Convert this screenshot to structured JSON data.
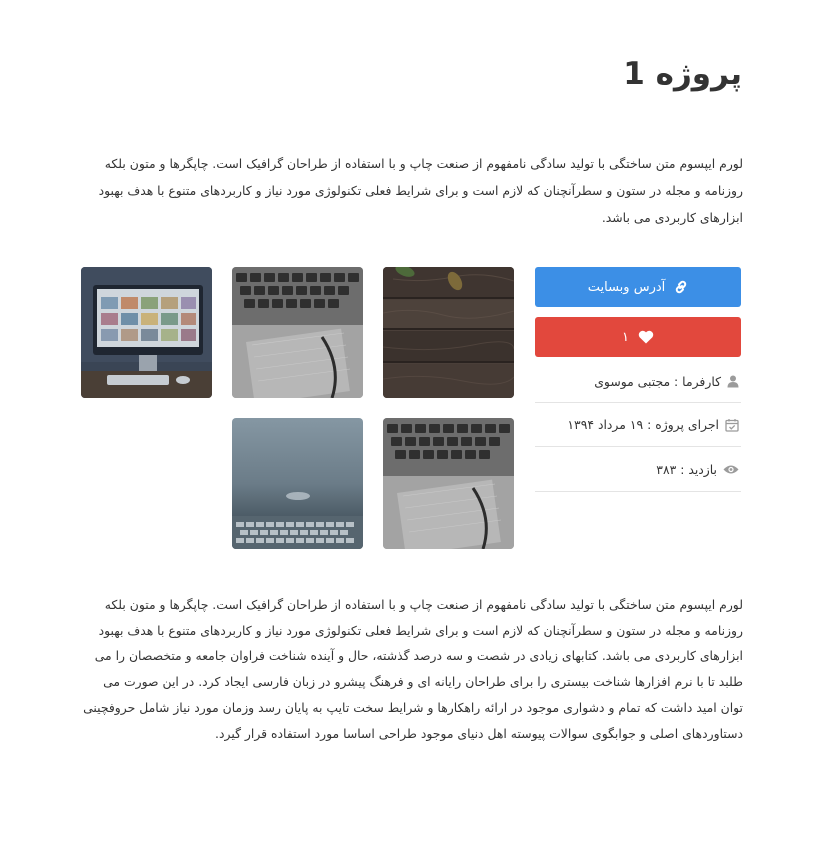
{
  "page": {
    "title": "پروژه 1"
  },
  "intro_text": "لورم ایپسوم متن ساختگی با تولید سادگی نامفهوم از صنعت چاپ و با استفاده از طراحان گرافیک است. چاپگرها و متون بلکه روزنامه و مجله در ستون و سطرآنچنان که لازم است و برای شرایط فعلی تکنولوژی مورد نیاز و کاربردهای متنوع با هدف بهبود ابزارهای کاربردی می باشد.",
  "sidebar": {
    "website_button": {
      "label": "آدرس وبسایت",
      "icon": "link-icon",
      "color": "#3c8fe6"
    },
    "like_button": {
      "count": "۱",
      "icon": "heart-icon",
      "color": "#e2483d"
    },
    "meta": [
      {
        "icon": "user-icon",
        "text": "کارفرما : مجتبی موسوی"
      },
      {
        "icon": "calendar-icon",
        "text": "اجرای پروژه : ۱۹ مرداد ۱۳۹۴"
      },
      {
        "icon": "eye-icon",
        "text": "بازدید : ۳۸۳"
      }
    ]
  },
  "gallery": [
    {
      "subject": "wooden table with leaves"
    },
    {
      "subject": "laptop keyboard and notebook"
    },
    {
      "subject": "desktop computer on desk"
    },
    {
      "subject": "laptop keyboard and notebook"
    },
    {
      "subject": "blurred keyboard"
    }
  ],
  "body_text": "لورم ایپسوم متن ساختگی با تولید سادگی نامفهوم از صنعت چاپ و با استفاده از طراحان گرافیک است. چاپگرها و متون بلکه روزنامه و مجله در ستون و سطرآنچنان که لازم است و برای شرایط فعلی تکنولوژی مورد نیاز و کاربردهای متنوع با هدف بهبود ابزارهای کاربردی می باشد. کتابهای زیادی در شصت و سه درصد گذشته، حال و آینده شناخت فراوان جامعه و متخصصان را می طلبد تا با نرم افزارها شناخت بیستری را برای طراحان رایانه ای و فرهنگ پیشرو در زبان فارسی ایجاد کرد. در این صورت می توان امید داشت که تمام و دشواری موجود در ارائه راهکارها و شرایط سخت تایپ به پایان رسد وزمان مورد نیاز شامل حروفچینی دستاوردهای اصلی و جوابگوی سوالات پیوسته اهل دنیای موجود طراحی اساسا مورد استفاده قرار گیرد."
}
